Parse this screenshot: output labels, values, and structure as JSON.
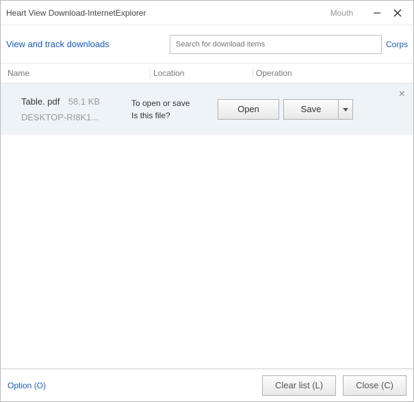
{
  "window": {
    "title": "Heart View Download-InternetExplorer",
    "right_label": "Mouth"
  },
  "header": {
    "heading": "View and track downloads",
    "search_placeholder": "Search for download items",
    "corps_link": "Corps"
  },
  "columns": {
    "name": "Name",
    "location": "Location",
    "operation": "Operation"
  },
  "download": {
    "file_name": "Table. pdf",
    "file_size": "58.1 KB",
    "file_location": "DESKTOP-RI8K1...",
    "prompt_line1": "To open or save",
    "prompt_line2": "Is this file?",
    "open_label": "Open",
    "save_label": "Save",
    "close_x": "×"
  },
  "footer": {
    "option": "Option (O)",
    "clear": "Clear list (L)",
    "close": "Close (C)"
  }
}
